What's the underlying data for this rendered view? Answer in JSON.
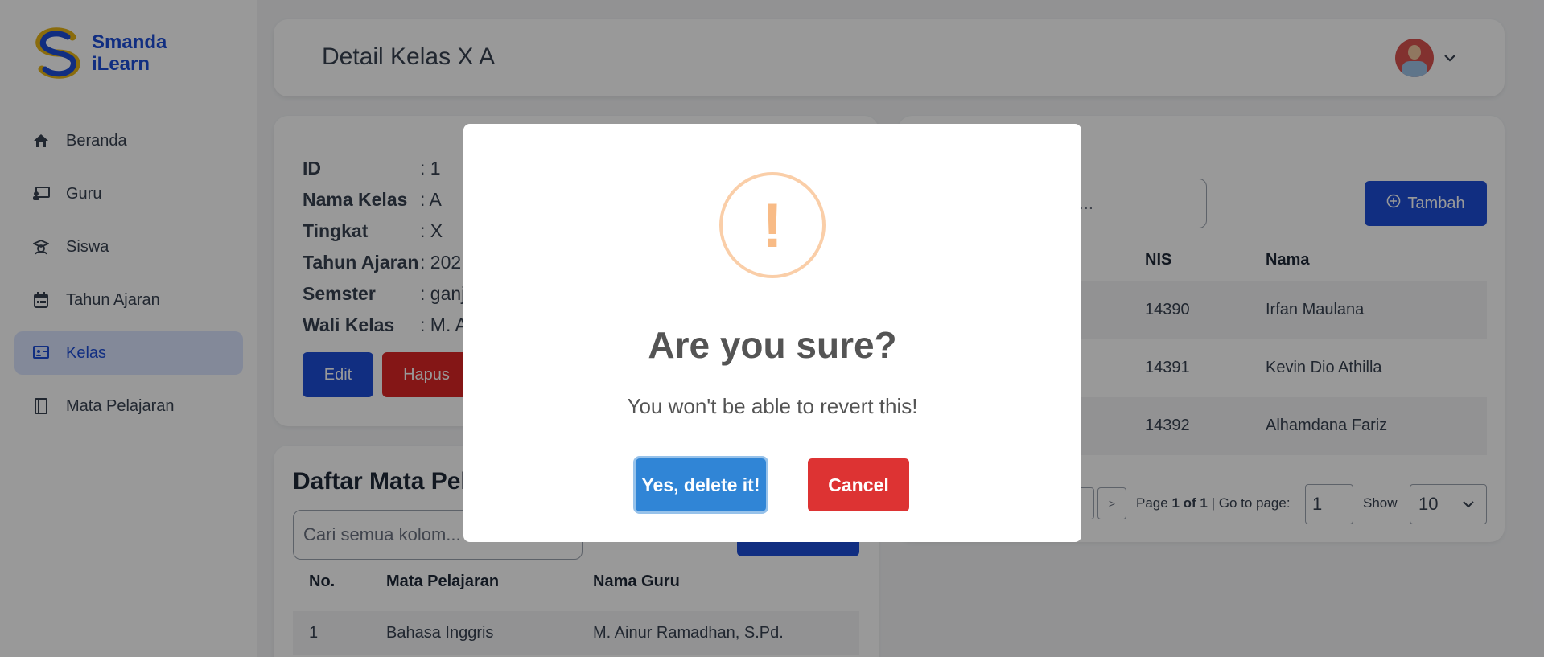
{
  "app": {
    "logo_line1": "Smanda",
    "logo_line2": "iLearn",
    "brand_color": "#1d4ed8",
    "logo_accent": "#e7b416"
  },
  "sidebar": {
    "items": [
      {
        "label": "Beranda",
        "icon": "home-icon",
        "active": false
      },
      {
        "label": "Guru",
        "icon": "teacher-icon",
        "active": false
      },
      {
        "label": "Siswa",
        "icon": "student-icon",
        "active": false
      },
      {
        "label": "Tahun Ajaran",
        "icon": "calendar-icon",
        "active": false
      },
      {
        "label": "Kelas",
        "icon": "classroom-icon",
        "active": true
      },
      {
        "label": "Mata Pelajaran",
        "icon": "book-icon",
        "active": false
      }
    ]
  },
  "header": {
    "title": "Detail Kelas X A"
  },
  "detail": {
    "rows": [
      {
        "label": "ID",
        "value": ": 1"
      },
      {
        "label": "Nama Kelas",
        "value": ": A"
      },
      {
        "label": "Tingkat",
        "value": ": X"
      },
      {
        "label": "Tahun Ajaran",
        "value": ": 202"
      },
      {
        "label": "Semster",
        "value": ": ganj"
      },
      {
        "label": "Wali Kelas",
        "value": ": M. A"
      }
    ],
    "edit_label": "Edit",
    "delete_label": "Hapus"
  },
  "mapel": {
    "title": "Daftar Mata Pel",
    "search_placeholder": "Cari semua kolom...",
    "headers": [
      "No.",
      "Mata Pelajaran",
      "Nama Guru"
    ],
    "rows": [
      {
        "no": "1",
        "mapel": "Bahasa Inggris",
        "guru": "M. Ainur Ramadhan, S.Pd."
      }
    ]
  },
  "siswa": {
    "search_placeholder": "a...",
    "add_label": "Tambah",
    "headers": [
      "NIS",
      "Nama"
    ],
    "rows": [
      {
        "nis": "14390",
        "nama": "Irfan Maulana"
      },
      {
        "nis": "14391",
        "nama": "Kevin Dio Athilla"
      },
      {
        "nis": "14392",
        "nama": "Alhamdana Fariz"
      }
    ],
    "pager": {
      "next": ">",
      "page_prefix": "Page",
      "page_value": "1 of 1",
      "goto_label": "| Go to page:",
      "goto_value": "1",
      "show_label": "Show",
      "show_value": "10"
    }
  },
  "modal": {
    "icon": "!",
    "title": "Are you sure?",
    "text": "You won't be able to revert this!",
    "confirm_label": "Yes, delete it!",
    "cancel_label": "Cancel",
    "confirm_color": "#3085d6",
    "cancel_color": "#dd3333",
    "icon_color": "#f8bb86"
  }
}
